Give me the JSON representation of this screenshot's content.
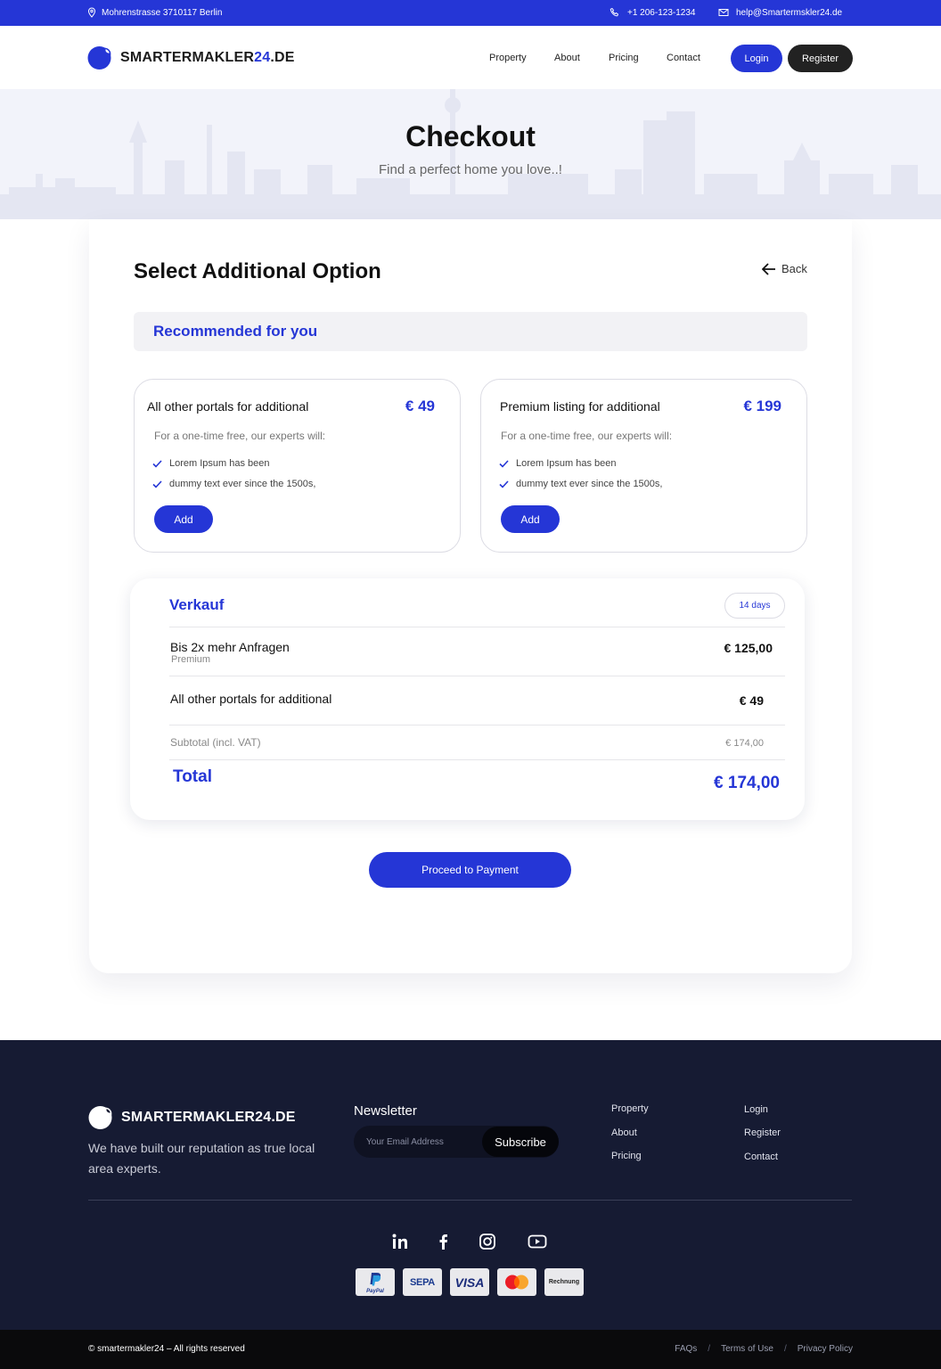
{
  "topbar": {
    "address": "Mohrenstrasse 3710117 Berlin",
    "phone": "+1 206-123-1234",
    "email": "help@Smartermskler24.de"
  },
  "brand": {
    "name_main": "SMARTERMAKLER",
    "name_accent": "24",
    "name_suffix": ".DE",
    "footer_name": "SMARTERMAKLER24.DE",
    "accent_color": "#2536d6"
  },
  "nav": {
    "items": [
      "Property",
      "About",
      "Pricing",
      "Contact"
    ],
    "login": "Login",
    "register": "Register"
  },
  "hero": {
    "title": "Checkout",
    "subtitle": "Find a perfect home you love..!"
  },
  "options_section": {
    "title": "Select Additional Option",
    "back": "Back",
    "recommended": "Recommended for you",
    "options": [
      {
        "title": "All other portals for additional",
        "price": "€ 49",
        "desc": "For a one-time free, our experts will:",
        "items": [
          "Lorem Ipsum has been",
          "dummy text ever since the 1500s,"
        ],
        "button": "Add"
      },
      {
        "title": "Premium listing for additional",
        "price": "€ 199",
        "desc": "For a one-time free, our experts will:",
        "items": [
          "Lorem Ipsum has been",
          "dummy text ever since the 1500s,"
        ],
        "button": "Add"
      }
    ]
  },
  "summary": {
    "title": "Verkauf",
    "duration": "14 days",
    "rows": [
      {
        "name": "Bis 2x mehr Anfragen",
        "sub": "Premium",
        "value": "€ 125,00"
      },
      {
        "name": "All other portals for additional",
        "value": "€ 49"
      }
    ],
    "subtotal_label": "Subtotal (incl. VAT)",
    "subtotal_value": "€ 174,00",
    "total_label": "Total",
    "total_value": "€ 174,00"
  },
  "proceed": "Proceed to Payment",
  "footer": {
    "tagline": "We have built our reputation as true local area experts.",
    "newsletter_title": "Newsletter",
    "email_placeholder": "Your Email Address",
    "subscribe": "Subscribe",
    "links_col1": [
      "Property",
      "About",
      "Pricing"
    ],
    "links_col2": [
      "Login",
      "Register",
      "Contact"
    ],
    "social": [
      "linkedin-icon",
      "facebook-icon",
      "instagram-icon",
      "youtube-icon"
    ],
    "payments": {
      "paypal": "PayPal",
      "sepa": "SEPA",
      "visa": "VISA",
      "mastercard": "mastercard",
      "invoice": "Rechnung"
    },
    "copyright": "© smartermakler24 – All rights reserved",
    "bottom_links": [
      "FAQs",
      "Terms of Use",
      "Privacy Policy"
    ]
  }
}
